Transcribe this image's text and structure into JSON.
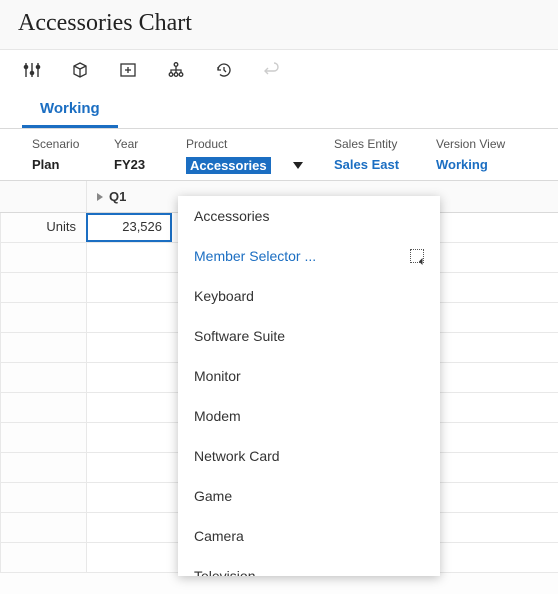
{
  "title": "Accessories Chart",
  "tabs": {
    "working": "Working"
  },
  "pov": {
    "scenario": {
      "label": "Scenario",
      "value": "Plan"
    },
    "year": {
      "label": "Year",
      "value": "FY23"
    },
    "product": {
      "label": "Product",
      "value": "Accessories"
    },
    "sales_entity": {
      "label": "Sales Entity",
      "value": "Sales East"
    },
    "version_view": {
      "label": "Version View",
      "value": "Working"
    }
  },
  "grid": {
    "col_header": "Q1",
    "row_header": "Units",
    "value": "23,526",
    "blank_rows": 11
  },
  "dropdown": {
    "member_selector": "Member Selector ...",
    "items": [
      "Accessories",
      "Keyboard",
      "Software Suite",
      "Monitor",
      "Modem",
      "Network Card",
      "Game",
      "Camera",
      "Television"
    ]
  }
}
